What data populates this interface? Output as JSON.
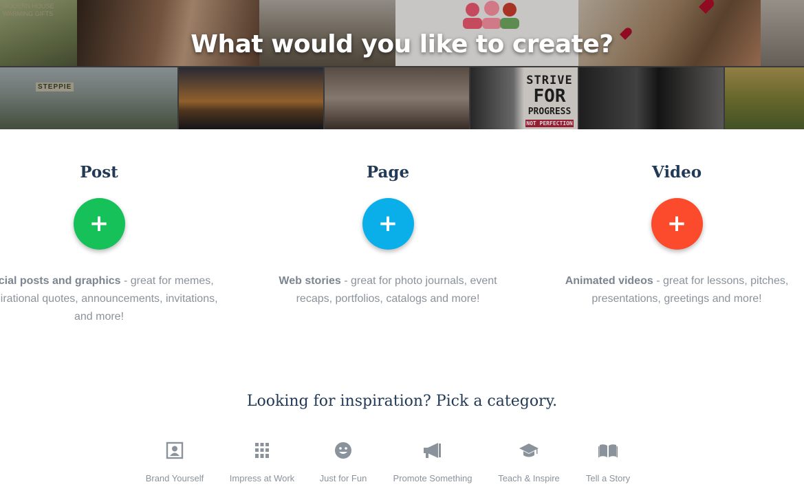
{
  "hero": {
    "title": "What would you like to create?",
    "sign_text": "MODERN HOUSE\nWARMING GIFTS",
    "banner_text": "STEPPIE",
    "poster": {
      "line1": "STRIVE",
      "line2": "FOR",
      "line3": "PROGRESS",
      "line4": "NOT PERFECTION"
    }
  },
  "options": [
    {
      "title": "Post",
      "color": "#16c15a",
      "icon": "plus-icon",
      "glyph": "+",
      "desc_bold": "Social posts and graphics",
      "desc_rest": " - great for memes, inspirational quotes, announcements, invitations, and more!"
    },
    {
      "title": "Page",
      "color": "#0aaee9",
      "icon": "plus-icon",
      "glyph": "+",
      "desc_bold": "Web stories",
      "desc_rest": " - great for photo journals, event recaps, portfolios, catalogs and more!"
    },
    {
      "title": "Video",
      "color": "#fb4a2c",
      "icon": "plus-icon",
      "glyph": "+",
      "desc_bold": "Animated videos",
      "desc_rest": " - great for lessons, pitches, presentations, greetings and more!"
    }
  ],
  "inspiration": {
    "title": "Looking for inspiration? Pick a category.",
    "icon_color": "#8a929b",
    "categories": [
      {
        "label": "Brand Yourself",
        "icon": "portrait-icon"
      },
      {
        "label": "Impress at Work",
        "icon": "building-icon"
      },
      {
        "label": "Just for Fun",
        "icon": "smiley-icon"
      },
      {
        "label": "Promote Something",
        "icon": "megaphone-icon"
      },
      {
        "label": "Teach & Inspire",
        "icon": "graduation-cap-icon"
      },
      {
        "label": "Tell a Story",
        "icon": "book-icon"
      }
    ]
  }
}
